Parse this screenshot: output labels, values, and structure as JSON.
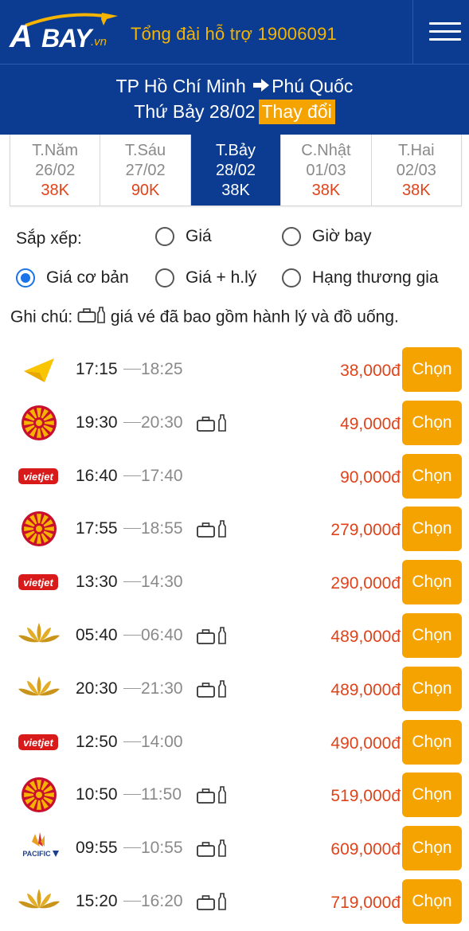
{
  "header": {
    "logo_text_a": "A",
    "logo_text_bay": "BAY",
    "logo_text_vn": ".vn",
    "hotline": "Tổng đài hỗ trợ 19006091"
  },
  "route": {
    "from": "TP Hồ Chí Minh",
    "to": "Phú Quốc",
    "date": "Thứ Bảy 28/02",
    "change_label": "Thay đổi"
  },
  "date_tabs": [
    {
      "day": "T.Năm",
      "date": "26/02",
      "price": "38K",
      "active": false
    },
    {
      "day": "T.Sáu",
      "date": "27/02",
      "price": "90K",
      "active": false
    },
    {
      "day": "T.Bảy",
      "date": "28/02",
      "price": "38K",
      "active": true
    },
    {
      "day": "C.Nhật",
      "date": "01/03",
      "price": "38K",
      "active": false
    },
    {
      "day": "T.Hai",
      "date": "02/03",
      "price": "38K",
      "active": false
    }
  ],
  "sort": {
    "label": "Sắp xếp:",
    "options": [
      {
        "label": "Giá",
        "checked": false
      },
      {
        "label": "Giờ bay",
        "checked": false
      },
      {
        "label": "Giá cơ bản",
        "checked": true
      },
      {
        "label": "Giá + h.lý",
        "checked": false
      },
      {
        "label": "Hạng thương gia",
        "checked": false
      }
    ]
  },
  "note": {
    "prefix": "Ghi chú:",
    "text": "giá vé đã bao gồm hành lý và đồ uống."
  },
  "flights": [
    {
      "airline": "jetstar",
      "depart": "17:15",
      "arrive": "18:25",
      "bag": false,
      "price": "38,000đ",
      "button": "Chọn"
    },
    {
      "airline": "bamboo",
      "depart": "19:30",
      "arrive": "20:30",
      "bag": true,
      "price": "49,000đ",
      "button": "Chọn"
    },
    {
      "airline": "vietjet",
      "depart": "16:40",
      "arrive": "17:40",
      "bag": false,
      "price": "90,000đ",
      "button": "Chọn"
    },
    {
      "airline": "bamboo",
      "depart": "17:55",
      "arrive": "18:55",
      "bag": true,
      "price": "279,000đ",
      "button": "Chọn"
    },
    {
      "airline": "vietjet",
      "depart": "13:30",
      "arrive": "14:30",
      "bag": false,
      "price": "290,000đ",
      "button": "Chọn"
    },
    {
      "airline": "vietnam-airlines",
      "depart": "05:40",
      "arrive": "06:40",
      "bag": true,
      "price": "489,000đ",
      "button": "Chọn"
    },
    {
      "airline": "vietnam-airlines",
      "depart": "20:30",
      "arrive": "21:30",
      "bag": true,
      "price": "489,000đ",
      "button": "Chọn"
    },
    {
      "airline": "vietjet",
      "depart": "12:50",
      "arrive": "14:00",
      "bag": false,
      "price": "490,000đ",
      "button": "Chọn"
    },
    {
      "airline": "bamboo",
      "depart": "10:50",
      "arrive": "11:50",
      "bag": true,
      "price": "519,000đ",
      "button": "Chọn"
    },
    {
      "airline": "pacific",
      "depart": "09:55",
      "arrive": "10:55",
      "bag": true,
      "price": "609,000đ",
      "button": "Chọn"
    },
    {
      "airline": "vietnam-airlines",
      "depart": "15:20",
      "arrive": "16:20",
      "bag": true,
      "price": "719,000đ",
      "button": "Chọn"
    }
  ],
  "logo_labels": {
    "vietjet": "vietjet",
    "pacific": "PACIFIC"
  },
  "colors": {
    "primary": "#0b3c91",
    "accent": "#f5a300",
    "price": "#e0431a",
    "radio": "#1a73e8"
  },
  "icons": {
    "menu": "hamburger-icon",
    "route_arrow": "arrow-right-icon",
    "baggage": "suitcase-icon",
    "drink": "bottle-icon"
  }
}
